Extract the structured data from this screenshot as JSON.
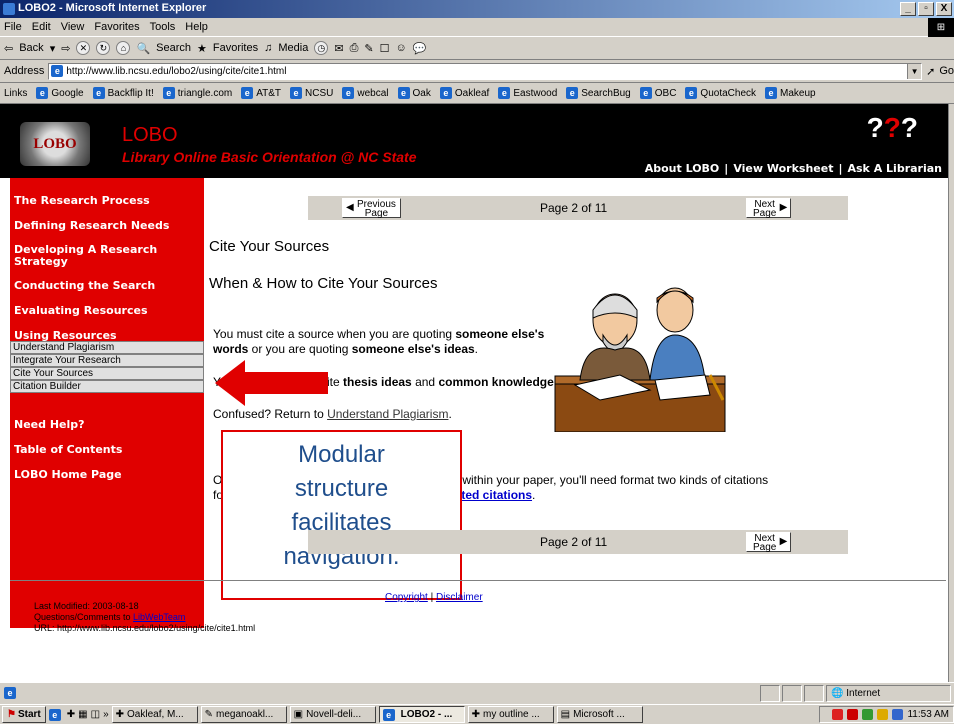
{
  "window": {
    "title": "LOBO2 - Microsoft Internet Explorer",
    "controls": [
      "_",
      "̲̅",
      "X"
    ]
  },
  "menu": [
    "File",
    "Edit",
    "View",
    "Favorites",
    "Tools",
    "Help"
  ],
  "toolbar": {
    "back": "Back",
    "search": "Search",
    "favorites": "Favorites",
    "media": "Media"
  },
  "address": {
    "label": "Address",
    "url": "http://www.lib.ncsu.edu/lobo2/using/cite/cite1.html",
    "go": "Go"
  },
  "links": {
    "label": "Links",
    "items": [
      "Google",
      "Backflip It!",
      "triangle.com",
      "AT&T",
      "NCSU",
      "webcal",
      "Oak",
      "Oakleaf",
      "Eastwood",
      "SearchBug",
      "OBC",
      "QuotaCheck",
      "Makeup"
    ]
  },
  "header": {
    "logo": "LOBO",
    "title": "LOBO",
    "subtitle": "Library Online Basic Orientation @ NC State",
    "links": [
      "About LOBO",
      "View Worksheet",
      "Ask A Librarian"
    ],
    "sep": "|"
  },
  "sidebar": {
    "items": [
      "The Research Process",
      "Defining Research Needs",
      "Developing A Research Strategy",
      "Conducting the Search",
      "Evaluating Resources",
      "Using Resources"
    ],
    "sub": [
      "Understand Plagiarism",
      "Integrate Your Research",
      "Cite Your Sources",
      "Citation Builder"
    ],
    "bottom": [
      "Need Help?",
      "Table of Contents",
      "LOBO Home Page"
    ]
  },
  "nav": {
    "prev_line1": "Previous",
    "prev_line2": "Page",
    "next_line1": "Next",
    "next_line2": "Page",
    "page_of": "Page 2 of 11"
  },
  "content": {
    "heading1": "Cite Your Sources",
    "heading2": "When & How to Cite Your Sources",
    "p1_a": "You must cite a source when you are quoting ",
    "p1_b": "someone else's words",
    "p1_c": " or you are quoting ",
    "p1_d": "someone else's ideas",
    "p1_e": ".",
    "p2_a": "Y",
    "p2_b": "cite ",
    "p2_c": "thesis ideas",
    "p2_d": " and ",
    "p2_e": "common knowledge",
    "p2_f": ".",
    "p3_a": "Confused? Return to ",
    "p3_link": "Understand Plagiarism",
    "p3_b": ".",
    "p4_a": "O",
    "p4_b": "within your paper, you'll need format two kinds of citations",
    "p4_c": "fo",
    "p4_link": "ited citations",
    "p4_d": "."
  },
  "callout": {
    "line1": "Modular",
    "line2": "structure",
    "line3": "facilitates",
    "line4": "navigation."
  },
  "footer": {
    "links": [
      "Copyright",
      "Disclaimer"
    ],
    "sep": "|",
    "modified": "Last Modified: 2003-08-18",
    "comments": "Questions/Comments to ",
    "comments_link": "LibWebTeam",
    "url": "URL: http://www.lib.ncsu.edu/lobo2/using/cite/cite1.html"
  },
  "status": {
    "zone": "Internet"
  },
  "taskbar": {
    "start": "Start",
    "chevron": "»",
    "buttons": [
      "Oakleaf, M...",
      "meganoakl...",
      "Novell-deli...",
      "LOBO2 - ...",
      "my outline ...",
      "Microsoft ..."
    ],
    "clock": "11:53 AM"
  }
}
